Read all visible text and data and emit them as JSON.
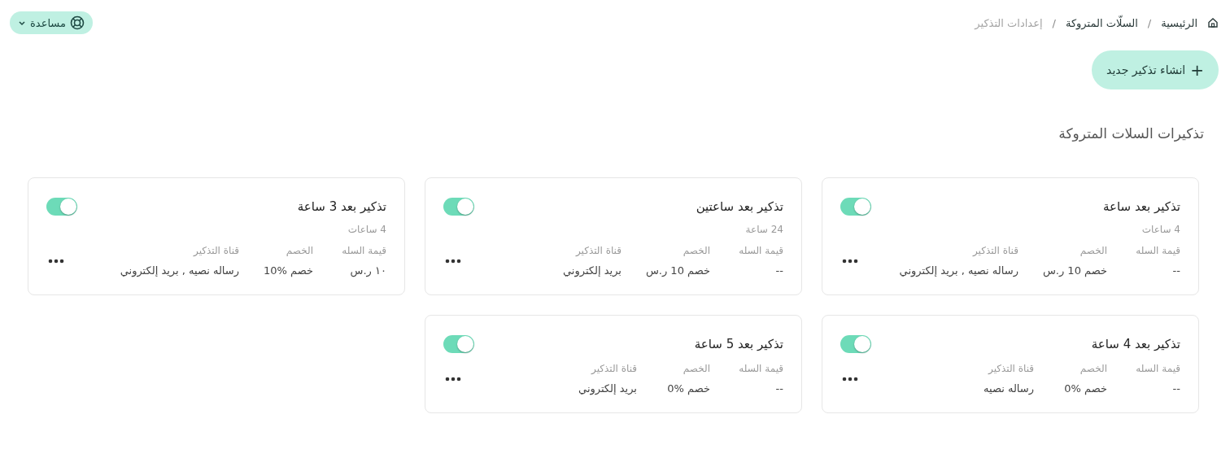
{
  "help_button": {
    "label": "مساعدة"
  },
  "breadcrumb": [
    {
      "label": "الرئيسية",
      "current": false
    },
    {
      "label": "السلّات المتروكة",
      "current": false
    },
    {
      "label": "إعدادات التذكير",
      "current": true
    }
  ],
  "breadcrumb_separator": "/",
  "create_button": {
    "icon": "+",
    "label": "انشاء تذكير جديد"
  },
  "section_title": "تذكيرات السلات المتروكة",
  "cards": [
    {
      "title": "تذكير بعد ساعة",
      "subtitle": "4 ساعات",
      "on": true,
      "fields": [
        {
          "label": "قيمة السله",
          "value": "--"
        },
        {
          "label": "الخصم",
          "value": "خصم 10 ر.س"
        },
        {
          "label": "قناة التذكير",
          "value": "رساله نصيه , بريد إلكتروني"
        }
      ]
    },
    {
      "title": "تذكير بعد ساعتين",
      "subtitle": "24 ساعة",
      "on": true,
      "fields": [
        {
          "label": "قيمة السله",
          "value": "--"
        },
        {
          "label": "الخصم",
          "value": "خصم 10 ر.س"
        },
        {
          "label": "قناة التذكير",
          "value": "بريد إلكتروني"
        }
      ]
    },
    {
      "title": "تذكير بعد 3 ساعة",
      "subtitle": "4 ساعات",
      "on": true,
      "fields": [
        {
          "label": "قيمة السله",
          "value": "١٠ ر.س"
        },
        {
          "label": "الخصم",
          "value": "خصم %10"
        },
        {
          "label": "قناة التذكير",
          "value": "رساله نصيه , بريد إلكتروني"
        }
      ]
    },
    {
      "title": "تذكير بعد 4 ساعة",
      "on": true,
      "fields": [
        {
          "label": "قيمة السله",
          "value": "--"
        },
        {
          "label": "الخصم",
          "value": "خصم %0"
        },
        {
          "label": "قناة التذكير",
          "value": "رساله نصيه"
        }
      ]
    },
    {
      "title": "تذكير بعد 5 ساعة",
      "on": true,
      "fields": [
        {
          "label": "قيمة السله",
          "value": "--"
        },
        {
          "label": "الخصم",
          "value": "خصم %0"
        },
        {
          "label": "قناة التذكير",
          "value": "بريد إلكتروني"
        }
      ]
    }
  ]
}
